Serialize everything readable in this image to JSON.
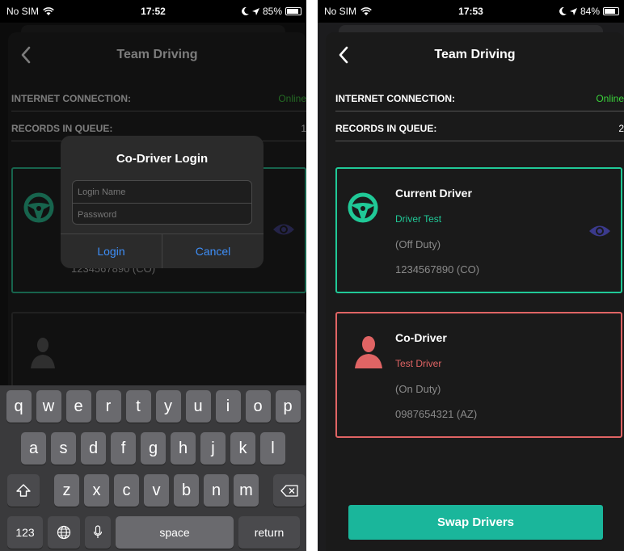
{
  "left": {
    "status": {
      "carrier": "No SIM",
      "time": "17:52",
      "battery": "85%",
      "battery_level": 0.85
    },
    "nav": {
      "title": "Team Driving"
    },
    "rows": [
      {
        "label": "INTERNET CONNECTION:",
        "value": "Online"
      },
      {
        "label": "RECORDS IN QUEUE:",
        "value": "1"
      }
    ],
    "current_driver": {
      "id_line": "1234567890 (CO)"
    },
    "dialog": {
      "title": "Co-Driver Login",
      "login_placeholder": "Login Name",
      "password_placeholder": "Password",
      "login_button": "Login",
      "cancel_button": "Cancel"
    },
    "keyboard": {
      "row1": [
        "q",
        "w",
        "e",
        "r",
        "t",
        "y",
        "u",
        "i",
        "o",
        "p"
      ],
      "row2": [
        "a",
        "s",
        "d",
        "f",
        "g",
        "h",
        "j",
        "k",
        "l"
      ],
      "row3": [
        "z",
        "x",
        "c",
        "v",
        "b",
        "n",
        "m"
      ],
      "numbers_key": "123",
      "space_key": "space",
      "return_key": "return"
    }
  },
  "right": {
    "status": {
      "carrier": "No SIM",
      "time": "17:53",
      "battery": "84%",
      "battery_level": 0.84
    },
    "nav": {
      "title": "Team Driving"
    },
    "rows": [
      {
        "label": "INTERNET CONNECTION:",
        "value": "Online"
      },
      {
        "label": "RECORDS IN QUEUE:",
        "value": "2"
      }
    ],
    "current_driver": {
      "heading": "Current Driver",
      "name": "Driver Test",
      "status": "(Off Duty)",
      "id_line": "1234567890 (CO)"
    },
    "co_driver": {
      "heading": "Co-Driver",
      "name": "Test Driver",
      "status": "(On Duty)",
      "id_line": "0987654321 (AZ)"
    },
    "swap_button": "Swap Drivers"
  },
  "colors": {
    "green": "#20c997",
    "red": "#e06464",
    "eye": "#3b3a8c",
    "online": "#3ad13a",
    "swap": "#1ab69b",
    "ios_blue": "#3e8ef7"
  }
}
